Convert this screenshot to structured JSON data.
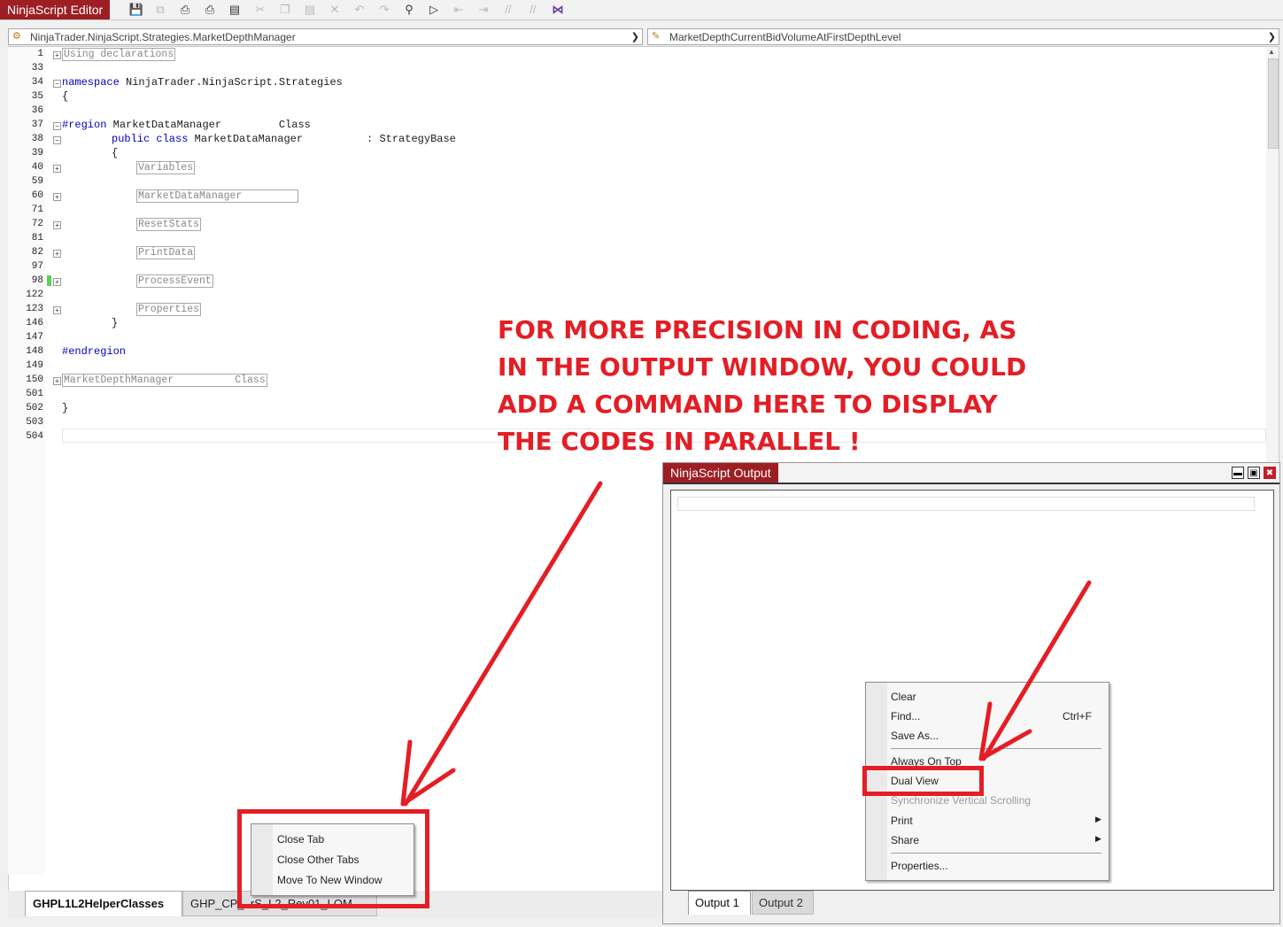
{
  "editor": {
    "title": "NinjaScript Editor",
    "class_selector": "NinjaTrader.NinjaScript.Strategies.MarketDepthManager",
    "member_selector": "MarketDepthCurrentBidVolumeAtFirstDepthLevel",
    "toolbar_icons": [
      "save-icon",
      "save-all-icon",
      "print-icon",
      "print-preview-icon",
      "properties-icon",
      "cut-icon",
      "copy-icon",
      "paste-icon",
      "delete-icon",
      "undo-icon",
      "redo-icon",
      "find-icon",
      "command-icon",
      "outdent-icon",
      "indent-icon",
      "comment-icon",
      "uncomment-icon",
      "visual-studio-icon"
    ],
    "lines": [
      {
        "n": "1",
        "fold": "+",
        "collapsed": "Using declarations"
      },
      {
        "n": "33"
      },
      {
        "n": "34",
        "fold": "-",
        "keyword": "namespace",
        "text": " NinjaTrader.NinjaScript.Strategies"
      },
      {
        "n": "35",
        "text": "{"
      },
      {
        "n": "36"
      },
      {
        "n": "37",
        "fold": "-",
        "keyword": "#region",
        "text": " MarketDataManager         Class"
      },
      {
        "n": "38",
        "fold": "-",
        "keyword": "public class",
        "text": " MarketDataManager          : StrategyBase"
      },
      {
        "n": "39",
        "text": "{"
      },
      {
        "n": "40",
        "fold": "+",
        "collapsed": "Variables"
      },
      {
        "n": "59"
      },
      {
        "n": "60",
        "fold": "+",
        "collapsed": "MarketDataManager         "
      },
      {
        "n": "71"
      },
      {
        "n": "72",
        "fold": "+",
        "collapsed": "ResetStats"
      },
      {
        "n": "81"
      },
      {
        "n": "82",
        "fold": "+",
        "collapsed": "PrintData"
      },
      {
        "n": "97"
      },
      {
        "n": "98",
        "fold": "+",
        "collapsed": "ProcessEvent"
      },
      {
        "n": "122"
      },
      {
        "n": "123",
        "fold": "+",
        "collapsed": "Properties"
      },
      {
        "n": "146",
        "text": "}"
      },
      {
        "n": "147"
      },
      {
        "n": "148",
        "keyword": "#endregion"
      },
      {
        "n": "149"
      },
      {
        "n": "150",
        "fold": "+",
        "collapsed": "MarketDepthManager          Class"
      },
      {
        "n": "501"
      },
      {
        "n": "502",
        "text": "}"
      },
      {
        "n": "503"
      },
      {
        "n": "504"
      }
    ],
    "tabs": [
      "GHPL1L2HelperClasses",
      "GHP_CP_..rS_L2_Rev01_LOM..."
    ],
    "tab_context_menu": [
      "Close Tab",
      "Close Other Tabs",
      "Move To New Window"
    ]
  },
  "annotation": {
    "lines": [
      "FOR MORE PRECISION IN CODING, AS",
      "IN THE OUTPUT WINDOW, YOU COULD",
      "ADD A COMMAND HERE TO DISPLAY",
      "THE CODES IN PARALLEL !"
    ],
    "color": "#e31e25"
  },
  "output": {
    "title": "NinjaScript Output",
    "tabs": [
      "Output 1",
      "Output 2"
    ],
    "context_menu": {
      "clear": "Clear",
      "find": "Find...",
      "find_shortcut": "Ctrl+F",
      "save_as": "Save As...",
      "always_on_top": "Always On Top",
      "dual_view": "Dual View",
      "sync_scroll": "Synchronize Vertical Scrolling",
      "print": "Print",
      "share": "Share",
      "properties": "Properties..."
    }
  },
  "colors": {
    "brand": "#9d1f24",
    "highlight": "#e31e25",
    "keyword": "#0000c0"
  }
}
